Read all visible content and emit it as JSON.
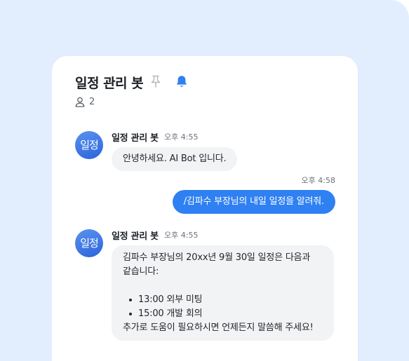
{
  "header": {
    "title": "일정 관리 봇",
    "member_count": "2",
    "pin_icon": "pin-icon",
    "bell_icon": "bell-icon",
    "accent": "#2f80f2"
  },
  "messages": [
    {
      "avatar_text": "일정",
      "sender": "일정 관리 봇",
      "time": "오후 4:55",
      "text": "안녕하세요. AI Bot 입니다."
    },
    {
      "time": "오후 4:58",
      "text": "/김파수 부장님의 내일 일정을 알려줘."
    },
    {
      "avatar_text": "일정",
      "sender": "일정 관리 봇",
      "time": "오후 4:55",
      "lines": [
        "김파수 부장님의 20xx년 9월 30일 일정은 다음과",
        "같습니다:"
      ],
      "bullets": [
        "13:00 외부 미팅",
        "15:00 개발 회의"
      ],
      "closing": "추가로 도움이 필요하시면 언제든지 말씀해 주세요!"
    }
  ]
}
